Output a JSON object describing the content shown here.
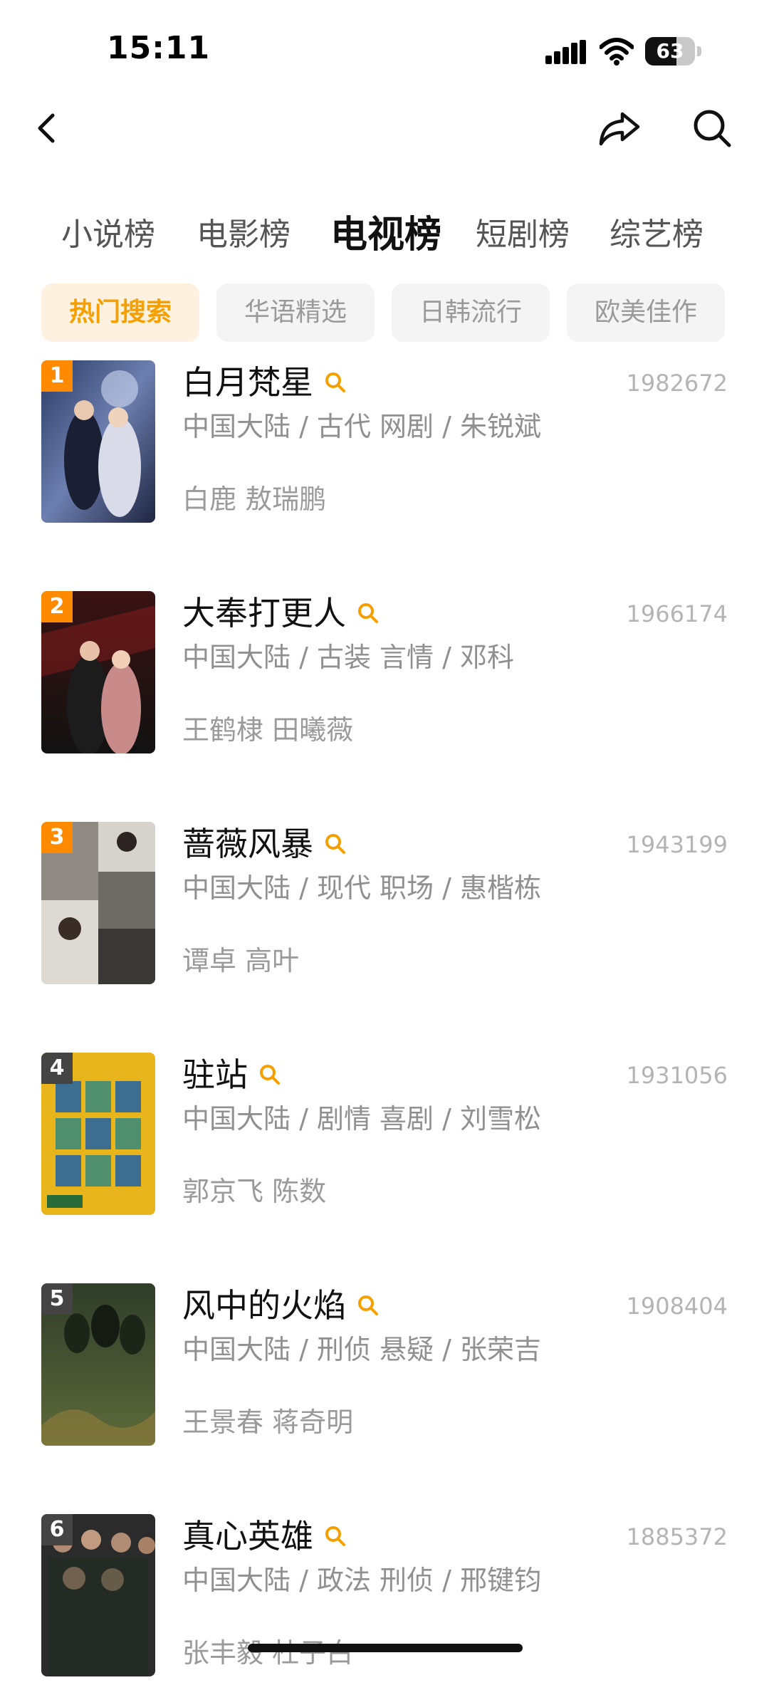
{
  "status_bar": {
    "time": "15:11",
    "battery": "63",
    "battery_level_percent": 63
  },
  "nav": {
    "back_icon": "chevron-left-icon",
    "share_icon": "share-icon",
    "search_icon": "search-icon"
  },
  "category_tabs": [
    {
      "label": "小说榜",
      "active": false
    },
    {
      "label": "电影榜",
      "active": false
    },
    {
      "label": "电视榜",
      "active": true
    },
    {
      "label": "短剧榜",
      "active": false
    },
    {
      "label": "综艺榜",
      "active": false
    }
  ],
  "filter_chips": [
    {
      "label": "热门搜索",
      "active": true
    },
    {
      "label": "华语精选",
      "active": false
    },
    {
      "label": "日韩流行",
      "active": false
    },
    {
      "label": "欧美佳作",
      "active": false
    }
  ],
  "colors": {
    "accent": "#f5a000",
    "rank_top": "#ff8a00",
    "rank_other": "#444444"
  },
  "list": [
    {
      "rank": "1",
      "title": "白月梵星",
      "count": "1982672",
      "meta": "中国大陆 / 古代 网剧 / 朱锐斌",
      "cast": "白鹿 敖瑞鹏"
    },
    {
      "rank": "2",
      "title": "大奉打更人",
      "count": "1966174",
      "meta": "中国大陆 / 古装 言情 / 邓科",
      "cast": "王鹤棣 田曦薇"
    },
    {
      "rank": "3",
      "title": "蔷薇风暴",
      "count": "1943199",
      "meta": "中国大陆 / 现代 职场 / 惠楷栋",
      "cast": "谭卓 高叶"
    },
    {
      "rank": "4",
      "title": "驻站",
      "count": "1931056",
      "meta": "中国大陆 / 剧情 喜剧 / 刘雪松",
      "cast": "郭京飞 陈数"
    },
    {
      "rank": "5",
      "title": "风中的火焰",
      "count": "1908404",
      "meta": "中国大陆 / 刑侦 悬疑 / 张荣吉",
      "cast": "王景春 蒋奇明"
    },
    {
      "rank": "6",
      "title": "真心英雄",
      "count": "1885372",
      "meta": "中国大陆 / 政法 刑侦 / 邢键钧",
      "cast": "张丰毅 杜子白"
    }
  ]
}
